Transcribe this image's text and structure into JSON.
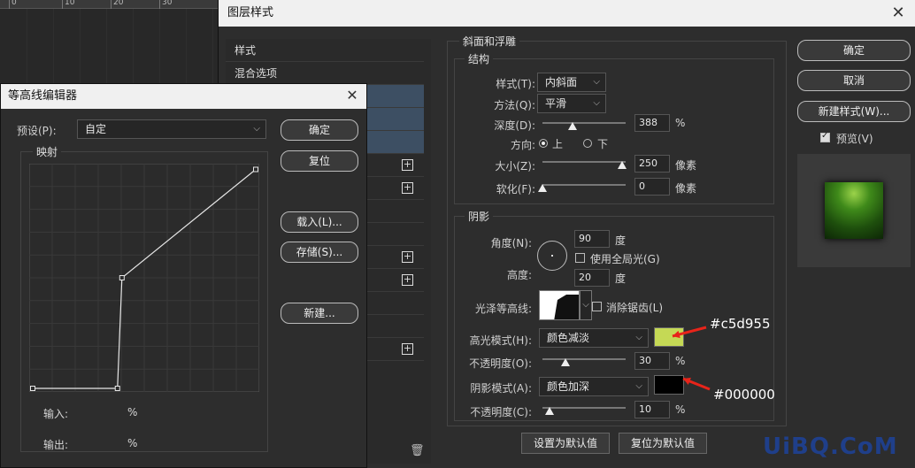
{
  "ruler": {
    "marks": [
      "0",
      "10",
      "20",
      "30"
    ]
  },
  "main": {
    "title": "图层样式",
    "close": "✕",
    "list": [
      {
        "label": "样式",
        "plus": false,
        "selected": false
      },
      {
        "label": "混合选项",
        "plus": false,
        "selected": false
      },
      {
        "label": "",
        "plus": false,
        "selected": true
      },
      {
        "label": "",
        "plus": false,
        "selected": true
      },
      {
        "label": "",
        "plus": false,
        "selected": true
      },
      {
        "label": "",
        "plus": true,
        "selected": false
      },
      {
        "label": "",
        "plus": true,
        "selected": false
      },
      {
        "label": "",
        "plus": false,
        "selected": false
      },
      {
        "label": "",
        "plus": false,
        "selected": false
      },
      {
        "label": "",
        "plus": true,
        "selected": false
      },
      {
        "label": "",
        "plus": true,
        "selected": false
      },
      {
        "label": "",
        "plus": false,
        "selected": false
      },
      {
        "label": "",
        "plus": false,
        "selected": false
      },
      {
        "label": "",
        "plus": true,
        "selected": false
      }
    ],
    "bevel": {
      "section_title": "斜面和浮雕",
      "structure_title": "结构",
      "style_label": "样式(T):",
      "style_value": "内斜面",
      "technique_label": "方法(Q):",
      "technique_value": "平滑",
      "depth_label": "深度(D):",
      "depth_value": "388",
      "depth_unit": "%",
      "direction_label": "方向:",
      "dir_up": "上",
      "dir_down": "下",
      "size_label": "大小(Z):",
      "size_value": "250",
      "size_unit": "像素",
      "soften_label": "软化(F):",
      "soften_value": "0",
      "soften_unit": "像素",
      "depth_slider": 0.36,
      "size_slider": 0.96,
      "soften_slider": 0.0
    },
    "shading": {
      "title": "阴影",
      "angle_label": "角度(N):",
      "angle_value": "90",
      "angle_unit": "度",
      "global_light_label": "使用全局光(G)",
      "altitude_label": "高度:",
      "altitude_value": "20",
      "altitude_unit": "度",
      "gloss_label": "光泽等高线:",
      "antialias_label": "消除锯齿(L)",
      "highlight_label": "高光模式(H):",
      "highlight_mode": "颜色减淡",
      "highlight_color": "#c5d955",
      "opacity1_label": "不透明度(O):",
      "opacity1_value": "30",
      "opacity1_unit": "%",
      "opacity1_slider": 0.28,
      "shadow_label": "阴影模式(A):",
      "shadow_mode": "颜色加深",
      "shadow_color": "#000000",
      "opacity2_label": "不透明度(C):",
      "opacity2_value": "10",
      "opacity2_unit": "%",
      "opacity2_slider": 0.08,
      "set_default": "设置为默认值",
      "reset_default": "复位为默认值"
    },
    "buttons": {
      "ok": "确定",
      "cancel": "取消",
      "new_style": "新建样式(W)...",
      "preview": "预览(V)"
    }
  },
  "contour_editor": {
    "title": "等高线编辑器",
    "close": "✕",
    "preset_label": "预设(P):",
    "preset_value": "自定",
    "mapping_title": "映射",
    "input_label": "输入:",
    "input_unit": "%",
    "output_label": "输出:",
    "output_unit": "%",
    "ok": "确定",
    "reset": "复位",
    "load": "载入(L)...",
    "save": "存储(S)...",
    "new": "新建...",
    "curve_points": [
      [
        0,
        0
      ],
      [
        0.38,
        0
      ],
      [
        0.4,
        0.5
      ],
      [
        1,
        0.99
      ]
    ]
  },
  "annotations": {
    "highlight_hex": "#c5d955",
    "shadow_hex": "#000000",
    "arrow_color": "#e8241a"
  },
  "watermark": "UiBQ.CoM"
}
